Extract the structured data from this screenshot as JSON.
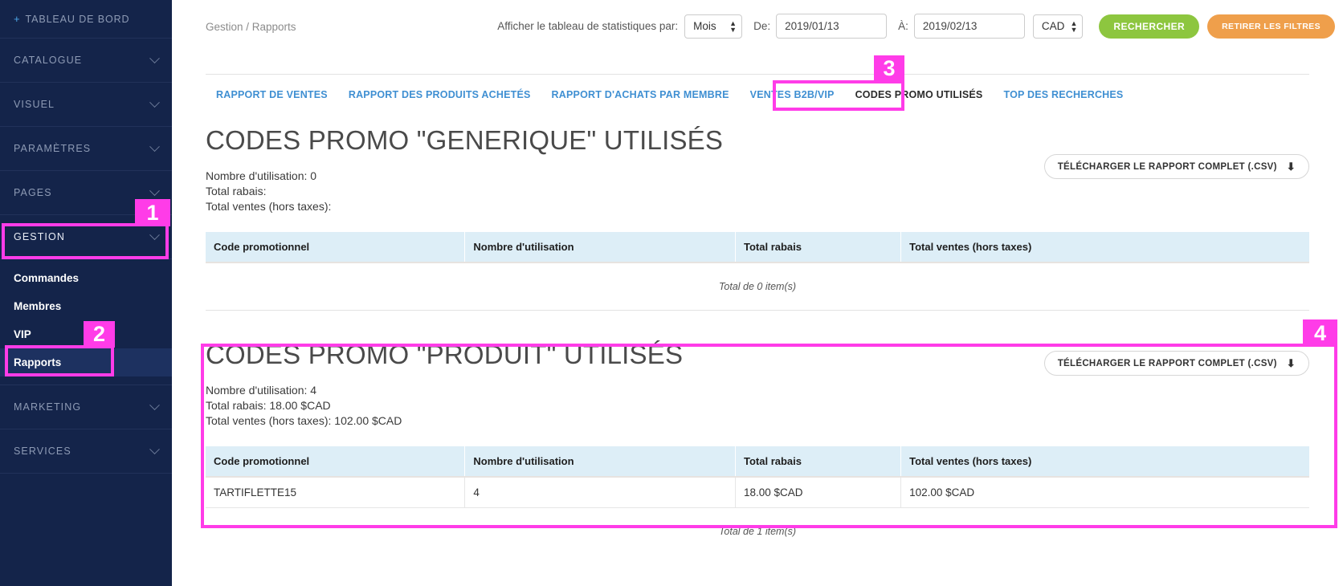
{
  "sidebar": {
    "dashboard": {
      "plus": "+",
      "label": "TABLEAU DE BORD"
    },
    "groups": [
      {
        "label": "CATALOGUE"
      },
      {
        "label": "VISUEL"
      },
      {
        "label": "PARAMÈTRES"
      },
      {
        "label": "PAGES"
      },
      {
        "label": "GESTION"
      },
      {
        "label": "MARKETING"
      },
      {
        "label": "SERVICES"
      }
    ],
    "gestion_items": [
      {
        "label": "Commandes"
      },
      {
        "label": "Membres"
      },
      {
        "label": "VIP"
      },
      {
        "label": "Rapports"
      }
    ]
  },
  "topbar": {
    "breadcrumb": "Gestion / Rapports",
    "stats_label": "Afficher le tableau de statistiques par:",
    "period_value": "Mois",
    "from_label": "De:",
    "from_value": "2019/01/13",
    "to_label": "À:",
    "to_value": "2019/02/13",
    "currency_value": "CAD",
    "search_button": "RECHERCHER",
    "clear_button": "RETIRER LES FILTRES"
  },
  "tabs": [
    {
      "label": "RAPPORT DE VENTES",
      "active": false
    },
    {
      "label": "RAPPORT DES PRODUITS ACHETÉS",
      "active": false
    },
    {
      "label": "RAPPORT D'ACHATS PAR MEMBRE",
      "active": false
    },
    {
      "label": "VENTES B2B/VIP",
      "active": false
    },
    {
      "label": "CODES PROMO UTILISÉS",
      "active": true
    },
    {
      "label": "TOP DES RECHERCHES",
      "active": false
    }
  ],
  "table_headers": [
    "Code promotionnel",
    "Nombre d'utilisation",
    "Total rabais",
    "Total ventes (hors taxes)"
  ],
  "download_button": {
    "label": "TÉLÉCHARGER LE RAPPORT COMPLET (.CSV)",
    "icon": "download-icon"
  },
  "section_generique": {
    "title": "CODES PROMO \"GENERIQUE\" UTILISÉS",
    "stat_count": "Nombre d'utilisation: 0",
    "stat_discount": "Total rabais:",
    "stat_sales": "Total ventes (hors taxes):",
    "rows": [],
    "total_line": "Total de 0 item(s)"
  },
  "section_produit": {
    "title": "CODES PROMO \"PRODUIT\" UTILISÉS",
    "stat_count": "Nombre d'utilisation: 4",
    "stat_discount": "Total rabais: 18.00 $CAD",
    "stat_sales": "Total ventes (hors taxes): 102.00 $CAD",
    "rows": [
      {
        "code": "TARTIFLETTE15",
        "uses": "4",
        "discount": "18.00 $CAD",
        "sales": "102.00 $CAD"
      }
    ],
    "total_line": "Total de 1 item(s)"
  },
  "annotations": {
    "color": "#ff3ce8",
    "markers": [
      {
        "id": "1",
        "target": "sidebar-group-gestion"
      },
      {
        "id": "2",
        "target": "sidebar-item-rapports"
      },
      {
        "id": "3",
        "target": "tab-codes-promo-utilises"
      },
      {
        "id": "4",
        "target": "section-codes-promo-produit"
      }
    ]
  }
}
